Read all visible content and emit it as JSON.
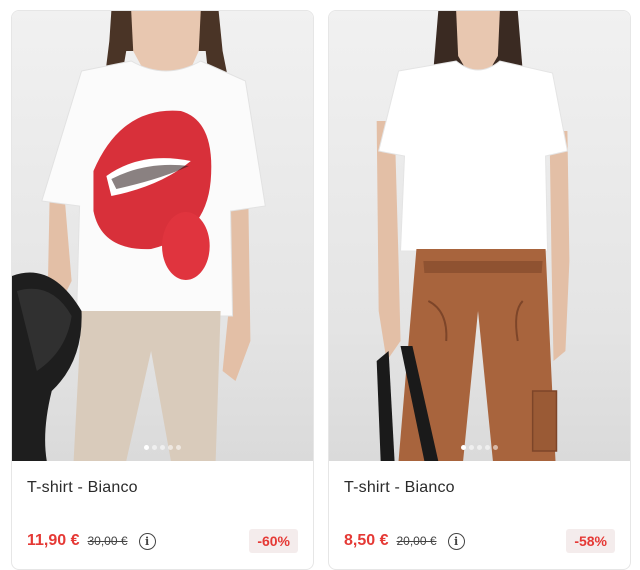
{
  "products": [
    {
      "name": "T-shirt - Bianco",
      "price": "11,90 €",
      "old_price": "30,00 €",
      "discount": "-60%",
      "info_icon": "info-icon",
      "image": "model wearing white t-shirt with red lips print",
      "carousel": {
        "total": 5,
        "active": 1
      }
    },
    {
      "name": "T-shirt - Bianco",
      "price": "8,50 €",
      "old_price": "20,00 €",
      "discount": "-58%",
      "info_icon": "info-icon",
      "image": "model wearing plain white t-shirt and brown leather trousers",
      "carousel": {
        "total": 5,
        "active": 1
      }
    }
  ],
  "colors": {
    "price_red": "#e53935",
    "badge_bg": "#f4ecec"
  }
}
